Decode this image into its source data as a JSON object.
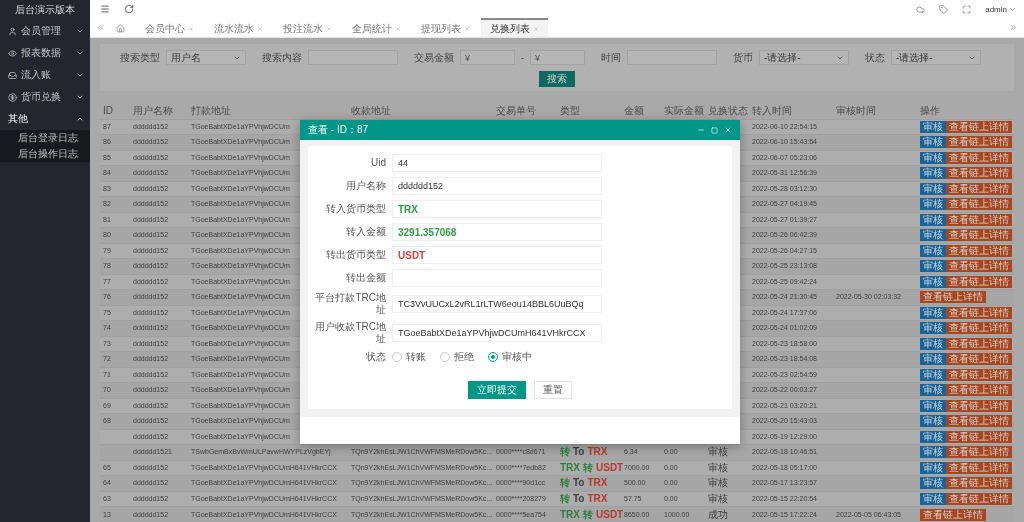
{
  "sidebar": {
    "title": "后台演示版本",
    "items": [
      {
        "label": "会员管理",
        "expanded": false
      },
      {
        "label": "报表数据",
        "expanded": false
      },
      {
        "label": "流入账",
        "expanded": false
      },
      {
        "label": "货币兑换",
        "expanded": false
      },
      {
        "label": "其他",
        "expanded": true,
        "children": [
          {
            "label": "后台登录日志"
          },
          {
            "label": "后台操作日志"
          }
        ]
      }
    ]
  },
  "header": {
    "user": "admin"
  },
  "tabs": [
    {
      "label": "会员中心",
      "selected": false
    },
    {
      "label": "流水流水",
      "selected": false
    },
    {
      "label": "投注流水",
      "selected": false
    },
    {
      "label": "全局统计",
      "selected": false
    },
    {
      "label": "提现列表",
      "selected": false
    },
    {
      "label": "兑换列表",
      "selected": true
    }
  ],
  "search": {
    "fields": [
      {
        "kind": "select",
        "label": "搜索类型",
        "value": "用户名"
      },
      {
        "kind": "text",
        "label": "搜索内容"
      },
      {
        "kind": "range",
        "label": "交易金额",
        "from_placeholder": "¥",
        "separator": "-",
        "to_placeholder": "¥"
      },
      {
        "kind": "text",
        "label": "时间"
      },
      {
        "kind": "select",
        "label": "货币",
        "value": "-请选择-"
      },
      {
        "kind": "select",
        "label": "状态",
        "value": "-请选择-"
      }
    ],
    "button": "搜索"
  },
  "table": {
    "columns": [
      "ID",
      "用户名称",
      "打款地址",
      "收款地址",
      "交易单号",
      "类型",
      "金额",
      "实际金额",
      "兑换状态",
      "转入时间",
      "审核时间",
      "操作"
    ],
    "rows": [
      {
        "id": "87",
        "user": "dddddd152",
        "pay_address": "TGoeBabtXDe1aYPVhjwDCUm",
        "in_time": "2022-06-10 22:54:15",
        "actions": [
          {
            "label": "审核",
            "kind": "primary"
          },
          {
            "label": "查看链上详情",
            "kind": "danger"
          }
        ]
      },
      {
        "id": "86",
        "user": "dddddd152",
        "pay_address": "TGoeBabtXDe1aYPVhjwDCUm",
        "in_time": "2022-06-10 15:43:54",
        "actions": [
          {
            "label": "审核",
            "kind": "primary"
          },
          {
            "label": "查看链上详情",
            "kind": "danger"
          }
        ]
      },
      {
        "id": "85",
        "user": "dddddd152",
        "pay_address": "TGoeBabtXDe1aYPVhjwDCUm",
        "in_time": "2022-06-07 05:23:06",
        "actions": [
          {
            "label": "审核",
            "kind": "primary"
          },
          {
            "label": "查看链上详情",
            "kind": "danger"
          }
        ]
      },
      {
        "id": "84",
        "user": "dddddd152",
        "pay_address": "TGoeBabtXDe1aYPVhjwDCUm",
        "in_time": "2022-05-31 12:56:39",
        "actions": [
          {
            "label": "审核",
            "kind": "primary"
          },
          {
            "label": "查看链上详情",
            "kind": "danger"
          }
        ]
      },
      {
        "id": "83",
        "user": "dddddd152",
        "pay_address": "TGoeBabtXDe1aYPVhjwDCUm",
        "in_time": "2022-05-28 03:12:30",
        "actions": [
          {
            "label": "审核",
            "kind": "primary"
          },
          {
            "label": "查看链上详情",
            "kind": "danger"
          }
        ]
      },
      {
        "id": "82",
        "user": "dddddd152",
        "pay_address": "TGoeBabtXDe1aYPVhjwDCUm",
        "in_time": "2022-05-27 04:19:45",
        "actions": [
          {
            "label": "审核",
            "kind": "primary"
          },
          {
            "label": "查看链上详情",
            "kind": "danger"
          }
        ]
      },
      {
        "id": "81",
        "user": "dddddd152",
        "pay_address": "TGoeBabtXDe1aYPVhjwDCUm",
        "in_time": "2022-05-27 01:39:27",
        "actions": [
          {
            "label": "审核",
            "kind": "primary"
          },
          {
            "label": "查看链上详情",
            "kind": "danger"
          }
        ]
      },
      {
        "id": "80",
        "user": "dddddd152",
        "pay_address": "TGoeBabtXDe1aYPVhjwDCUm",
        "in_time": "2022-05-26 06:42:39",
        "actions": [
          {
            "label": "审核",
            "kind": "primary"
          },
          {
            "label": "查看链上详情",
            "kind": "danger"
          }
        ]
      },
      {
        "id": "79",
        "user": "dddddd152",
        "pay_address": "TGoeBabtXDe1aYPVhjwDCUm",
        "in_time": "2022-05-26 04:27:15",
        "actions": [
          {
            "label": "审核",
            "kind": "primary"
          },
          {
            "label": "查看链上详情",
            "kind": "danger"
          }
        ]
      },
      {
        "id": "78",
        "user": "dddddd152",
        "pay_address": "TGoeBabtXDe1aYPVhjwDCUm",
        "in_time": "2022-05-25 23:13:08",
        "actions": [
          {
            "label": "审核",
            "kind": "primary"
          },
          {
            "label": "查看链上详情",
            "kind": "danger"
          }
        ]
      },
      {
        "id": "77",
        "user": "dddddd152",
        "pay_address": "TGoeBabtXDe1aYPVhjwDCUm",
        "in_time": "2022-05-25 09:42:24",
        "actions": [
          {
            "label": "审核",
            "kind": "primary"
          },
          {
            "label": "查看链上详情",
            "kind": "danger"
          }
        ]
      },
      {
        "id": "76",
        "user": "dddddd152",
        "pay_address": "TGoeBabtXDe1aYPVhjwDCUm",
        "in_time": "2022-05-24 21:30:45",
        "audit_time": "2022-05-30 02:03:32",
        "actions": [
          {
            "label": "查看链上详情",
            "kind": "danger"
          }
        ]
      },
      {
        "id": "75",
        "user": "dddddd152",
        "pay_address": "TGoeBabtXDe1aYPVhjwDCUm",
        "in_time": "2022-05-24 17:37:06",
        "actions": [
          {
            "label": "审核",
            "kind": "primary"
          },
          {
            "label": "查看链上详情",
            "kind": "danger"
          }
        ]
      },
      {
        "id": "74",
        "user": "dddddd152",
        "pay_address": "TGoeBabtXDe1aYPVhjwDCUm",
        "in_time": "2022-05-24 01:02:09",
        "actions": [
          {
            "label": "审核",
            "kind": "primary"
          },
          {
            "label": "查看链上详情",
            "kind": "danger"
          }
        ]
      },
      {
        "id": "73",
        "user": "dddddd152",
        "pay_address": "TGoeBabtXDe1aYPVhjwDCUm",
        "in_time": "2022-05-23 18:58:00",
        "actions": [
          {
            "label": "审核",
            "kind": "primary"
          },
          {
            "label": "查看链上详情",
            "kind": "danger"
          }
        ]
      },
      {
        "id": "72",
        "user": "dddddd152",
        "pay_address": "TGoeBabtXDe1aYPVhjwDCUm",
        "in_time": "2022-05-23 18:54:08",
        "actions": [
          {
            "label": "审核",
            "kind": "primary"
          },
          {
            "label": "查看链上详情",
            "kind": "danger"
          }
        ]
      },
      {
        "id": "71",
        "user": "dddddd152",
        "pay_address": "TGoeBabtXDe1aYPVhjwDCUm",
        "in_time": "2022-05-23 02:54:59",
        "actions": [
          {
            "label": "审核",
            "kind": "primary"
          },
          {
            "label": "查看链上详情",
            "kind": "danger"
          }
        ]
      },
      {
        "id": "70",
        "user": "dddddd152",
        "pay_address": "TGoeBabtXDe1aYPVhjwDCUm",
        "in_time": "2022-05-22 00:03:27",
        "actions": [
          {
            "label": "审核",
            "kind": "primary"
          },
          {
            "label": "查看链上详情",
            "kind": "danger"
          }
        ]
      },
      {
        "id": "69",
        "user": "dddddd152",
        "pay_address": "TGoeBabtXDe1aYPVhjwDCUm",
        "in_time": "2022-05-21 03:20:21",
        "actions": [
          {
            "label": "审核",
            "kind": "primary"
          },
          {
            "label": "查看链上详情",
            "kind": "danger"
          }
        ]
      },
      {
        "id": "68",
        "user": "dddddd152",
        "pay_address": "TGoeBabtXDe1aYPVhjwDCUm",
        "in_time": "2022-05-20 15:43:03",
        "actions": [
          {
            "label": "审核",
            "kind": "primary"
          },
          {
            "label": "查看链上详情",
            "kind": "danger"
          }
        ]
      },
      {
        "user": "dddddd152",
        "pay_address": "TGoeBabtXDe1aYPVhjwDCUm",
        "in_time": "2022-05-19 12:29:00",
        "actions": [
          {
            "label": "审核",
            "kind": "primary"
          },
          {
            "label": "查看链上详情",
            "kind": "danger"
          }
        ]
      },
      {
        "user": "dddddd1521",
        "pay_address": "TSwbGemBxBvWmULPavwHWYPLzVgbEYj",
        "recv_address": "TQn9Y2khEsLJW1ChVWFMSMeRDow5Kc...",
        "order_no": "0000****c8d671",
        "type": [
          {
            "text": "转",
            "color": "#2f7d3e"
          },
          {
            "text": "To"
          },
          {
            "text": "TRX",
            "color": "#b6382f"
          }
        ],
        "amount": "6.34",
        "actual": "0.00",
        "status": "审核",
        "in_time": "2022-05-18 10:46:51",
        "actions": [
          {
            "label": "审核",
            "kind": "primary"
          },
          {
            "label": "查看链上详情",
            "kind": "danger"
          }
        ]
      },
      {
        "id": "65",
        "user": "dddddd152",
        "pay_address": "TGoeBabtXDe1aYPVhjwDCUmH641VHkrCCX",
        "recv_address": "TQn9Y2khEsLJW1ChVWFMSMeRDow5Kc...",
        "order_no": "0000****7edb82",
        "type": [
          {
            "text": "TRX",
            "color": "#2f7d3e"
          },
          {
            "text": "转",
            "color": "#2f7d3e"
          },
          {
            "text": "USDT",
            "color": "#b6382f"
          }
        ],
        "amount": "7000.00",
        "actual": "0.00",
        "status": "审核",
        "in_time": "2022-05-18 05:17:00",
        "actions": [
          {
            "label": "审核",
            "kind": "primary"
          },
          {
            "label": "查看链上详情",
            "kind": "danger"
          }
        ]
      },
      {
        "id": "64",
        "user": "dddddd152",
        "pay_address": "TGoeBabtXDe1aYPVhjwDCUmH641VHkrCCX",
        "recv_address": "TQn9Y2khEsLJW1ChVWFMSMeRDow5Kc...",
        "order_no": "0000****90d1cc",
        "type": [
          {
            "text": "转",
            "color": "#2f7d3e"
          },
          {
            "text": "To"
          },
          {
            "text": "TRX",
            "color": "#b6382f"
          }
        ],
        "amount": "500.00",
        "actual": "0.00",
        "status": "审核",
        "in_time": "2022-05-17 13:23:57",
        "actions": [
          {
            "label": "审核",
            "kind": "primary"
          },
          {
            "label": "查看链上详情",
            "kind": "danger"
          }
        ]
      },
      {
        "id": "63",
        "user": "dddddd152",
        "pay_address": "TGoeBabtXDe1aYPVhjwDCUmH641VHkrCCX",
        "recv_address": "TQn9Y2khEsLJW1ChVWFMSMeRDow5Kc...",
        "order_no": "0000****208279",
        "type": [
          {
            "text": "转",
            "color": "#2f7d3e"
          },
          {
            "text": "To"
          },
          {
            "text": "TRX",
            "color": "#b6382f"
          }
        ],
        "amount": "57.75",
        "actual": "0.00",
        "status": "审核",
        "in_time": "2022-05-15 22:20:54",
        "actions": [
          {
            "label": "审核",
            "kind": "primary"
          },
          {
            "label": "查看链上详情",
            "kind": "danger"
          }
        ]
      },
      {
        "id": "13",
        "user": "dddddd152",
        "pay_address": "TGoeBabtXDe1aYPVhjwDCUmH641VHkrCCX",
        "recv_address": "TQn9Y2khEsLJW1ChVWFMSMeRDow5Kc...",
        "order_no": "0000****5ea754",
        "type": [
          {
            "text": "TRX",
            "color": "#2f7d3e"
          },
          {
            "text": "转",
            "color": "#2f7d3e"
          },
          {
            "text": "USDT",
            "color": "#b6382f"
          }
        ],
        "amount": "8650.00",
        "actual": "1000.00",
        "status": "成功",
        "in_time": "2022-05-15 17:22:24",
        "audit_time": "2022-05-05 06:43:05",
        "actions": [
          {
            "label": "查看链上详情",
            "kind": "danger"
          }
        ]
      }
    ]
  },
  "dialog": {
    "title": "查看 - ID：87",
    "fields": [
      {
        "label": "Uid",
        "value": "44"
      },
      {
        "label": "用户名称",
        "value": "dddddd152"
      },
      {
        "label": "转入货币类型",
        "value": "TRX",
        "color": "#2e9d48"
      },
      {
        "label": "转入金额",
        "value": "3291.357068",
        "color": "#2e9d48"
      },
      {
        "label": "转出货币类型",
        "value": "USDT",
        "color": "#e0413a"
      },
      {
        "label": "转出金额"
      },
      {
        "label": "平台打款TRC地址",
        "value": "TC3VvUUCxL2vRL1rLTW6eou14BBL6UuBQq"
      },
      {
        "label": "用户收款TRC地址",
        "value": "TGoeBabtXDe1aYPVhjwDCUmH641VHkrCCX"
      }
    ],
    "status": {
      "label": "状态",
      "options": [
        {
          "label": "转账",
          "selected": false
        },
        {
          "label": "拒绝",
          "selected": false
        },
        {
          "label": "审核中",
          "selected": true
        }
      ]
    },
    "buttons": [
      {
        "label": "立即提交",
        "kind": "primary"
      },
      {
        "label": "重置",
        "kind": "plain"
      }
    ]
  }
}
